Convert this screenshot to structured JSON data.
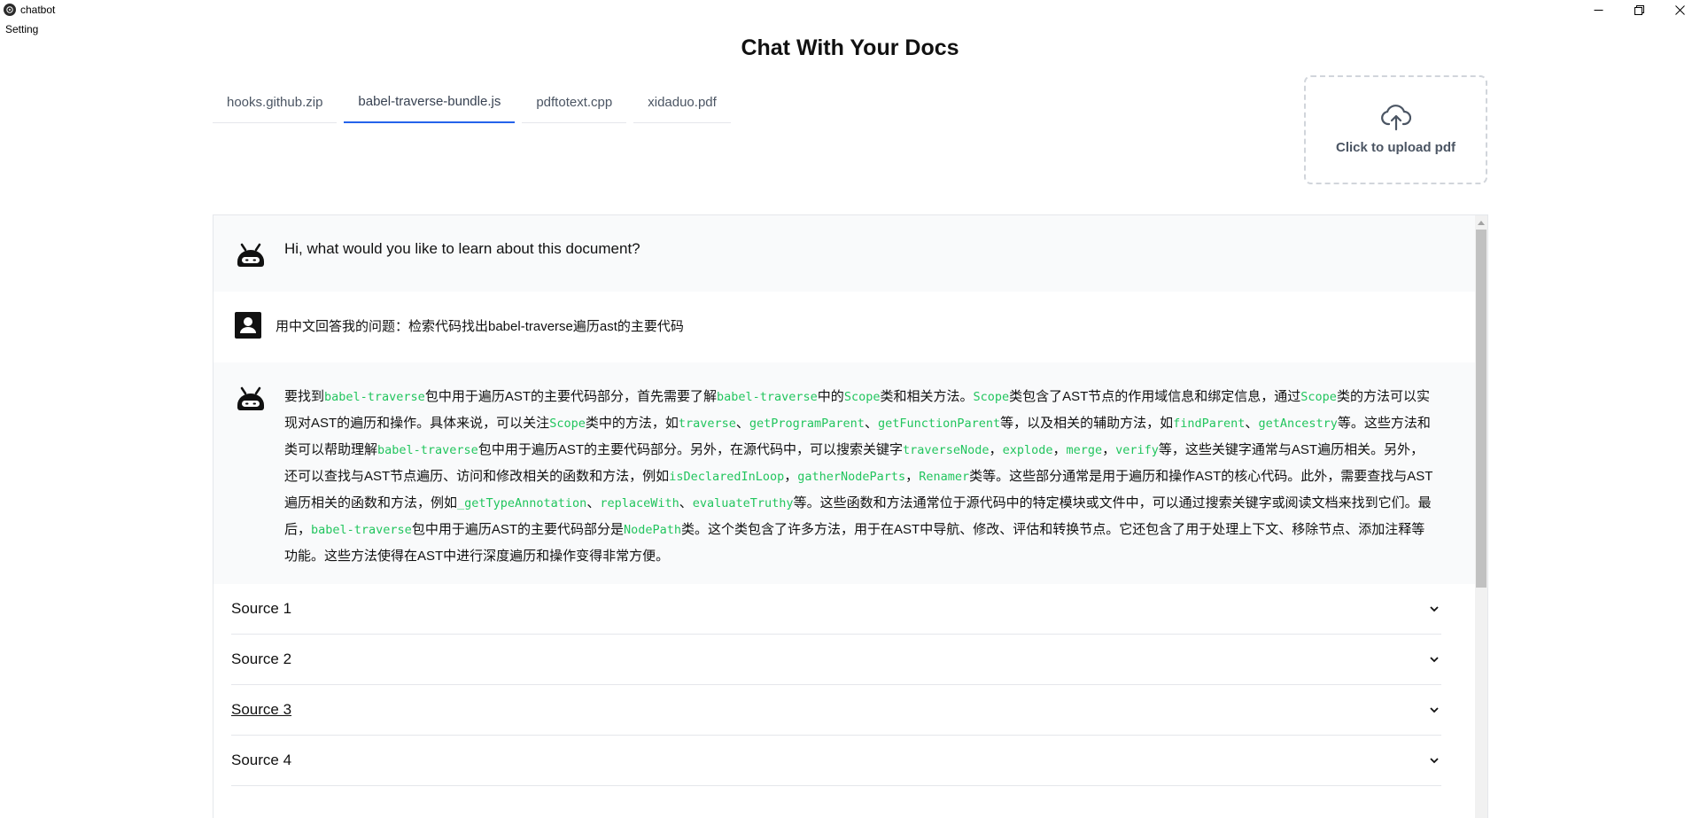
{
  "window": {
    "title": "chatbot"
  },
  "menu": {
    "setting": "Setting"
  },
  "page": {
    "title": "Chat With Your Docs"
  },
  "tabs": [
    {
      "label": "hooks.github.zip",
      "active": false
    },
    {
      "label": "babel-traverse-bundle.js",
      "active": true
    },
    {
      "label": "pdftotext.cpp",
      "active": false
    },
    {
      "label": "xidaduo.pdf",
      "active": false
    }
  ],
  "upload": {
    "label": "Click to upload pdf",
    "icon": "cloud-upload-icon"
  },
  "messages": {
    "greeting": "Hi, what would you like to learn about this document?",
    "user_question": "用中文回答我的问题：检索代码找出babel-traverse遍历ast的主要代码",
    "answer_segments": [
      {
        "t": "要找到"
      },
      {
        "t": "babel-traverse",
        "code": true
      },
      {
        "t": "包中用于遍历AST的主要代码部分，首先需要了解"
      },
      {
        "t": "babel-traverse",
        "code": true
      },
      {
        "t": "中的"
      },
      {
        "t": "Scope",
        "code": true
      },
      {
        "t": "类和相关方法。"
      },
      {
        "t": "Scope",
        "code": true
      },
      {
        "t": "类包含了AST节点的作用域信息和绑定信息，通过"
      },
      {
        "t": "Scope",
        "code": true
      },
      {
        "t": "类的方法可以实现对AST的遍历和操作。具体来说，可以关注"
      },
      {
        "t": "Scope",
        "code": true
      },
      {
        "t": "类中的方法，如"
      },
      {
        "t": "traverse",
        "code": true
      },
      {
        "t": "、"
      },
      {
        "t": "getProgramParent",
        "code": true
      },
      {
        "t": "、"
      },
      {
        "t": "getFunctionParent",
        "code": true
      },
      {
        "t": "等，以及相关的辅助方法，如"
      },
      {
        "t": "findParent",
        "code": true
      },
      {
        "t": "、"
      },
      {
        "t": "getAncestry",
        "code": true
      },
      {
        "t": "等。这些方法和类可以帮助理解"
      },
      {
        "t": "babel-traverse",
        "code": true
      },
      {
        "t": "包中用于遍历AST的主要代码部分。另外，在源代码中，可以搜索关键字"
      },
      {
        "t": "traverseNode",
        "code": true
      },
      {
        "t": "，"
      },
      {
        "t": "explode",
        "code": true
      },
      {
        "t": "，"
      },
      {
        "t": "merge",
        "code": true
      },
      {
        "t": "，"
      },
      {
        "t": "verify",
        "code": true
      },
      {
        "t": "等，这些关键字通常与AST遍历相关。另外，还可以查找与AST节点遍历、访问和修改相关的函数和方法，例如"
      },
      {
        "t": "isDeclaredInLoop",
        "code": true
      },
      {
        "t": "，"
      },
      {
        "t": "gatherNodeParts",
        "code": true
      },
      {
        "t": "，"
      },
      {
        "t": "Renamer",
        "code": true
      },
      {
        "t": "类等。这些部分通常是用于遍历和操作AST的核心代码。此外，需要查找与AST遍历相关的函数和方法，例如"
      },
      {
        "t": "_getTypeAnnotation",
        "code": true
      },
      {
        "t": "、"
      },
      {
        "t": "replaceWith",
        "code": true
      },
      {
        "t": "、"
      },
      {
        "t": "evaluateTruthy",
        "code": true
      },
      {
        "t": "等。这些函数和方法通常位于源代码中的特定模块或文件中，可以通过搜索关键字或阅读文档来找到它们。最后，"
      },
      {
        "t": "babel-traverse",
        "code": true
      },
      {
        "t": "包中用于遍历AST的主要代码部分是"
      },
      {
        "t": "NodePath",
        "code": true
      },
      {
        "t": "类。这个类包含了许多方法，用于在AST中导航、修改、评估和转换节点。它还包含了用于处理上下文、移除节点、添加注释等功能。这些方法使得在AST中进行深度遍历和操作变得非常方便。"
      }
    ]
  },
  "sources": [
    {
      "label": "Source 1"
    },
    {
      "label": "Source 2"
    },
    {
      "label": "Source 3"
    },
    {
      "label": "Source 4"
    }
  ],
  "colors": {
    "accent": "#2563eb",
    "code": "#22c55e"
  }
}
